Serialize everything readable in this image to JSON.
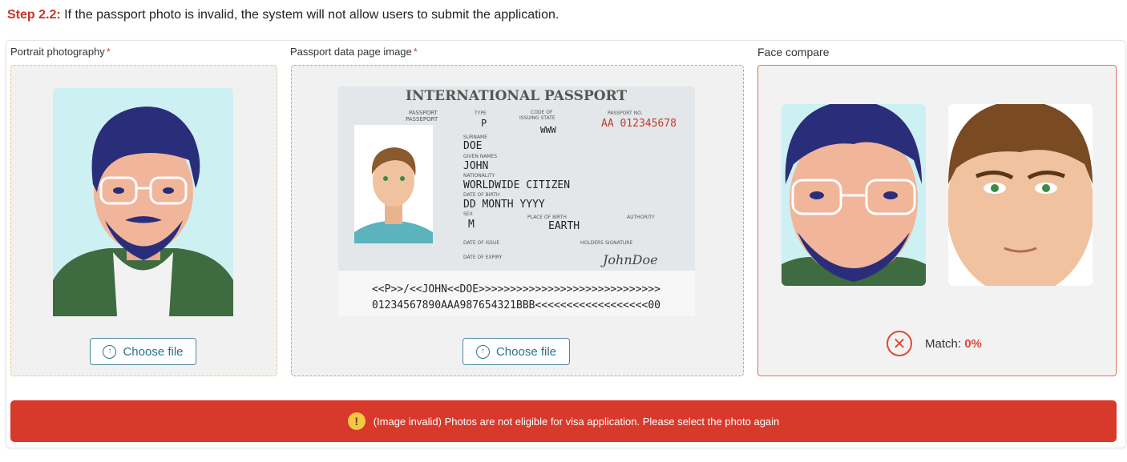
{
  "step": {
    "label": "Step 2.2:",
    "text": " If the passport photo is invalid, the system will not allow users to submit the application."
  },
  "portrait": {
    "label": "Portrait photography",
    "required_mark": "*",
    "button": "Choose file"
  },
  "passport": {
    "label": "Passport data page image",
    "required_mark": "*",
    "button": "Choose file",
    "doc": {
      "title": "INTERNATIONAL PASSPORT",
      "h_passport": "PASSPORT",
      "h_passeport": "PASSEPORT",
      "h_type": "TYPE",
      "h_code1": "CODE OF",
      "h_code2": "ISSUING STATE",
      "h_no": "PASSPORT NO.",
      "type": "P",
      "code": "WWW",
      "number": "AA 012345678",
      "l_surname": "SURNAME",
      "surname": "DOE",
      "l_given": "GIVEN NAMES",
      "given": "JOHN",
      "l_nationality": "NATIONALITY",
      "nationality": "WORLDWIDE CITIZEN",
      "l_dob": "DATE OF BIRTH",
      "dob": "DD MONTH YYYY",
      "l_sex": "SEX",
      "sex": "M",
      "l_pob": "PLACE OF BIRTH",
      "pob": "EARTH",
      "l_authority": "AUTHORITY",
      "l_issue": "DATE OF ISSUE",
      "l_holder": "HOLDERS SIGNATURE",
      "l_expiry": "DATE OF EXPIRY",
      "signature": "JohnDoe",
      "mrz1": "<<P>>/<<JOHN<<DOE>>>>>>>>>>>>>>>>>>>>>>>>>>>>>",
      "mrz2": "01234567890AAA987654321BBB<<<<<<<<<<<<<<<<<<00"
    }
  },
  "face_compare": {
    "label": "Face compare",
    "match_label": "Match:",
    "match_value": "0%"
  },
  "alert": {
    "icon": "!",
    "text": "(Image invalid) Photos are not eligible for visa application. Please select the photo again"
  },
  "colors": {
    "accent_red": "#d7392b",
    "step_red": "#c8342a",
    "button_teal": "#2f6f8a"
  }
}
